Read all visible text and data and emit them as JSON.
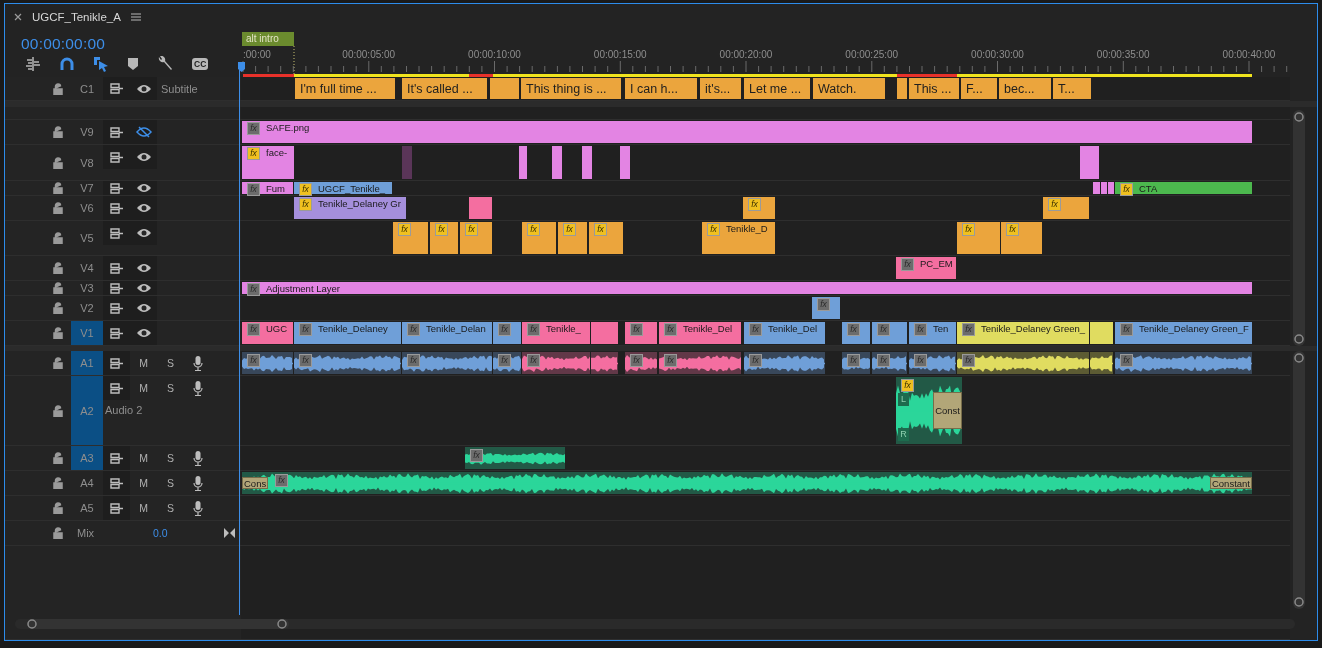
{
  "sequence": {
    "title": "UGCF_Tenikle_A",
    "timecode": "00:00:00:00"
  },
  "toolbar": [
    {
      "kind": "nest",
      "on": false
    },
    {
      "kind": "snap",
      "on": true
    },
    {
      "kind": "linked",
      "on": true
    },
    {
      "kind": "marker",
      "on": false
    },
    {
      "kind": "wrench",
      "on": false
    },
    {
      "kind": "captions",
      "label": "CC",
      "on": false
    }
  ],
  "marker": {
    "label": "alt intro"
  },
  "ruler": [
    ":00:00",
    "00:00:05:00",
    "00:00:10:00",
    "00:00:15:00",
    "00:00:20:00",
    "00:00:25:00",
    "00:00:30:00",
    "00:00:35:00",
    "00:00:40:00"
  ],
  "caption_track": {
    "label": "C1",
    "name": "Subtitle",
    "visible": true,
    "targeted": false,
    "captions": [
      {
        "kind": "text",
        "text": "I'm full time ..."
      },
      {
        "kind": "text",
        "text": "It's called ..."
      },
      {
        "kind": "blank"
      },
      {
        "kind": "text",
        "text": "This thing is ..."
      },
      {
        "kind": "text",
        "text": "I can h..."
      },
      {
        "kind": "text",
        "text": "it's..."
      },
      {
        "kind": "text",
        "text": "Let me ..."
      },
      {
        "kind": "text",
        "text": "Watch."
      },
      {
        "kind": "blank"
      },
      {
        "kind": "text",
        "text": "This ..."
      },
      {
        "kind": "text",
        "text": "F..."
      },
      {
        "kind": "text",
        "text": "bec..."
      },
      {
        "kind": "text",
        "text": "T..."
      }
    ]
  },
  "video_tracks": [
    {
      "label": "V9",
      "visible": false,
      "targeted": false,
      "clips": [
        {
          "name": "SAFE.png",
          "color": "#e384e3",
          "badge": "fx",
          "effects": false
        }
      ]
    },
    {
      "label": "V8",
      "visible": true,
      "targeted": false,
      "clips": [
        {
          "name": "face-",
          "color": "#e384e3",
          "badge": "fx",
          "effects": true
        },
        {
          "color": "#5a3558"
        },
        {
          "color": "#e384e3"
        },
        {
          "color": "#e384e3"
        },
        {
          "color": "#e384e3"
        },
        {
          "color": "#e384e3"
        },
        {
          "color": "#e384e3"
        }
      ]
    },
    {
      "label": "V7",
      "visible": true,
      "targeted": false,
      "clips": [
        {
          "name": "Fum",
          "color": "#e384e3",
          "badge": "fx",
          "effects": false
        },
        {
          "name": "UGCF_Tenikle_",
          "color": "#6f9fd8",
          "badge": "fx",
          "effects": true
        },
        {
          "color": "#e384e3"
        },
        {
          "color": "#e384e3"
        },
        {
          "color": "#e384e3"
        },
        {
          "name": "CTA",
          "color": "#4cb84e",
          "badge": "fx",
          "effects": true
        }
      ]
    },
    {
      "label": "V6",
      "visible": true,
      "targeted": false,
      "clips": [
        {
          "name": "Tenikle_Delaney Gr",
          "color": "#a58fdc",
          "badge": "fx",
          "effects": true
        },
        {
          "color": "#f46ea0"
        },
        {
          "color": "#eba53d",
          "badge": "fx",
          "effects": true
        },
        {
          "color": "#eba53d",
          "badge": "fx",
          "effects": true
        }
      ]
    },
    {
      "label": "V5",
      "visible": true,
      "targeted": false,
      "clips": [
        {
          "color": "#eba53d",
          "badge": "fx",
          "effects": true
        },
        {
          "color": "#eba53d",
          "badge": "fx",
          "effects": true
        },
        {
          "color": "#eba53d",
          "badge": "fx",
          "effects": true
        },
        {
          "color": "#eba53d",
          "badge": "fx",
          "effects": true
        },
        {
          "color": "#eba53d",
          "badge": "fx",
          "effects": true
        },
        {
          "color": "#eba53d",
          "badge": "fx",
          "effects": true
        },
        {
          "name": "Tenikle_D",
          "color": "#eba53d",
          "badge": "fx",
          "effects": true
        },
        {
          "color": "#eba53d",
          "badge": "fx",
          "effects": true
        },
        {
          "color": "#eba53d",
          "badge": "fx",
          "effects": true
        }
      ]
    },
    {
      "label": "V4",
      "visible": true,
      "targeted": false,
      "clips": [
        {
          "name": "PC_EM",
          "color": "#f46ea0",
          "badge": "fx",
          "effects": false
        }
      ]
    },
    {
      "label": "V3",
      "visible": true,
      "targeted": false,
      "clips": [
        {
          "name": "Adjustment Layer",
          "color": "#e384e3",
          "badge": "fx",
          "effects": false
        }
      ]
    },
    {
      "label": "V2",
      "visible": true,
      "targeted": false,
      "clips": [
        {
          "color": "#6f9fd8",
          "badge": "fx",
          "effects": false
        }
      ]
    },
    {
      "label": "V1",
      "visible": true,
      "targeted": true,
      "clips": [
        {
          "name": "UGC",
          "color": "#f46ea0",
          "badge": "fx",
          "effects": false
        },
        {
          "name": "Tenikle_Delaney",
          "color": "#6f9fd8",
          "badge": "fx",
          "effects": false
        },
        {
          "name": "Tenikle_Delan",
          "color": "#6f9fd8",
          "badge": "fx",
          "effects": false
        },
        {
          "color": "#6f9fd8",
          "badge": "fx",
          "effects": false
        },
        {
          "name": "Tenikle_",
          "color": "#f46ea0",
          "badge": "fx",
          "effects": false
        },
        {
          "color": "#f46ea0"
        },
        {
          "color": "#f46ea0",
          "badge": "fx",
          "effects": false
        },
        {
          "name": "Tenikle_Del",
          "color": "#f46ea0",
          "badge": "fx",
          "effects": false
        },
        {
          "name": "Tenikle_Del",
          "color": "#6f9fd8",
          "badge": "fx",
          "effects": false
        },
        {
          "color": "#6f9fd8",
          "badge": "fx",
          "effects": false
        },
        {
          "color": "#6f9fd8",
          "badge": "fx",
          "effects": false
        },
        {
          "name": "Ten",
          "color": "#6f9fd8",
          "badge": "fx",
          "effects": false
        },
        {
          "name": "Tenikle_Delaney Green_",
          "color": "#e0dc60",
          "badge": "fx",
          "effects": false
        },
        {
          "color": "#e0dc60"
        },
        {
          "name": "Tenikle_Delaney Green_F",
          "color": "#6f9fd8",
          "badge": "fx",
          "effects": false
        }
      ]
    }
  ],
  "audio_tracks": [
    {
      "label": "A1",
      "targeted": true,
      "mute": "M",
      "solo": "S",
      "clips": [
        {
          "color": "#6f9fd8",
          "badge": "fx",
          "effects": false
        },
        {
          "color": "#6f9fd8",
          "badge": "fx",
          "effects": false
        },
        {
          "color": "#6f9fd8",
          "badge": "fx",
          "effects": false
        },
        {
          "color": "#6f9fd8",
          "badge": "fx",
          "effects": false
        },
        {
          "color": "#f46ea0",
          "badge": "fx",
          "effects": false
        },
        {
          "color": "#f46ea0"
        },
        {
          "color": "#f46ea0",
          "badge": "fx",
          "effects": false
        },
        {
          "color": "#f46ea0",
          "badge": "fx",
          "effects": false
        },
        {
          "color": "#6f9fd8",
          "badge": "fx",
          "effects": false
        },
        {
          "color": "#6f9fd8",
          "badge": "fx",
          "effects": false
        },
        {
          "color": "#6f9fd8",
          "badge": "fx",
          "effects": false
        },
        {
          "color": "#6f9fd8",
          "badge": "fx",
          "effects": false
        },
        {
          "color": "#e0dc60",
          "badge": "fx",
          "effects": false
        },
        {
          "color": "#e0dc60"
        },
        {
          "color": "#6f9fd8",
          "badge": "fx",
          "effects": false
        }
      ]
    },
    {
      "label": "A2",
      "name": "Audio 2",
      "targeted": true,
      "mute": "M",
      "solo": "S",
      "clips": [
        {
          "color": "#2bd69a",
          "badge": "fx",
          "effects": true,
          "channels": [
            "L",
            "R"
          ],
          "end_transition": "Const"
        }
      ]
    },
    {
      "label": "A3",
      "targeted": true,
      "mute": "M",
      "solo": "S",
      "clips": [
        {
          "color": "#2bd69a",
          "badge": "fx",
          "effects": false
        }
      ]
    },
    {
      "label": "A4",
      "targeted": false,
      "mute": "M",
      "solo": "S",
      "clips": [
        {
          "color": "#2bd69a",
          "badge": "fx",
          "effects": false,
          "start_transition": "Cons",
          "end_transition": "Constant"
        }
      ]
    },
    {
      "label": "A5",
      "targeted": false,
      "mute": "M",
      "solo": "S"
    }
  ],
  "mix": {
    "label": "Mix",
    "value": "0.0"
  }
}
